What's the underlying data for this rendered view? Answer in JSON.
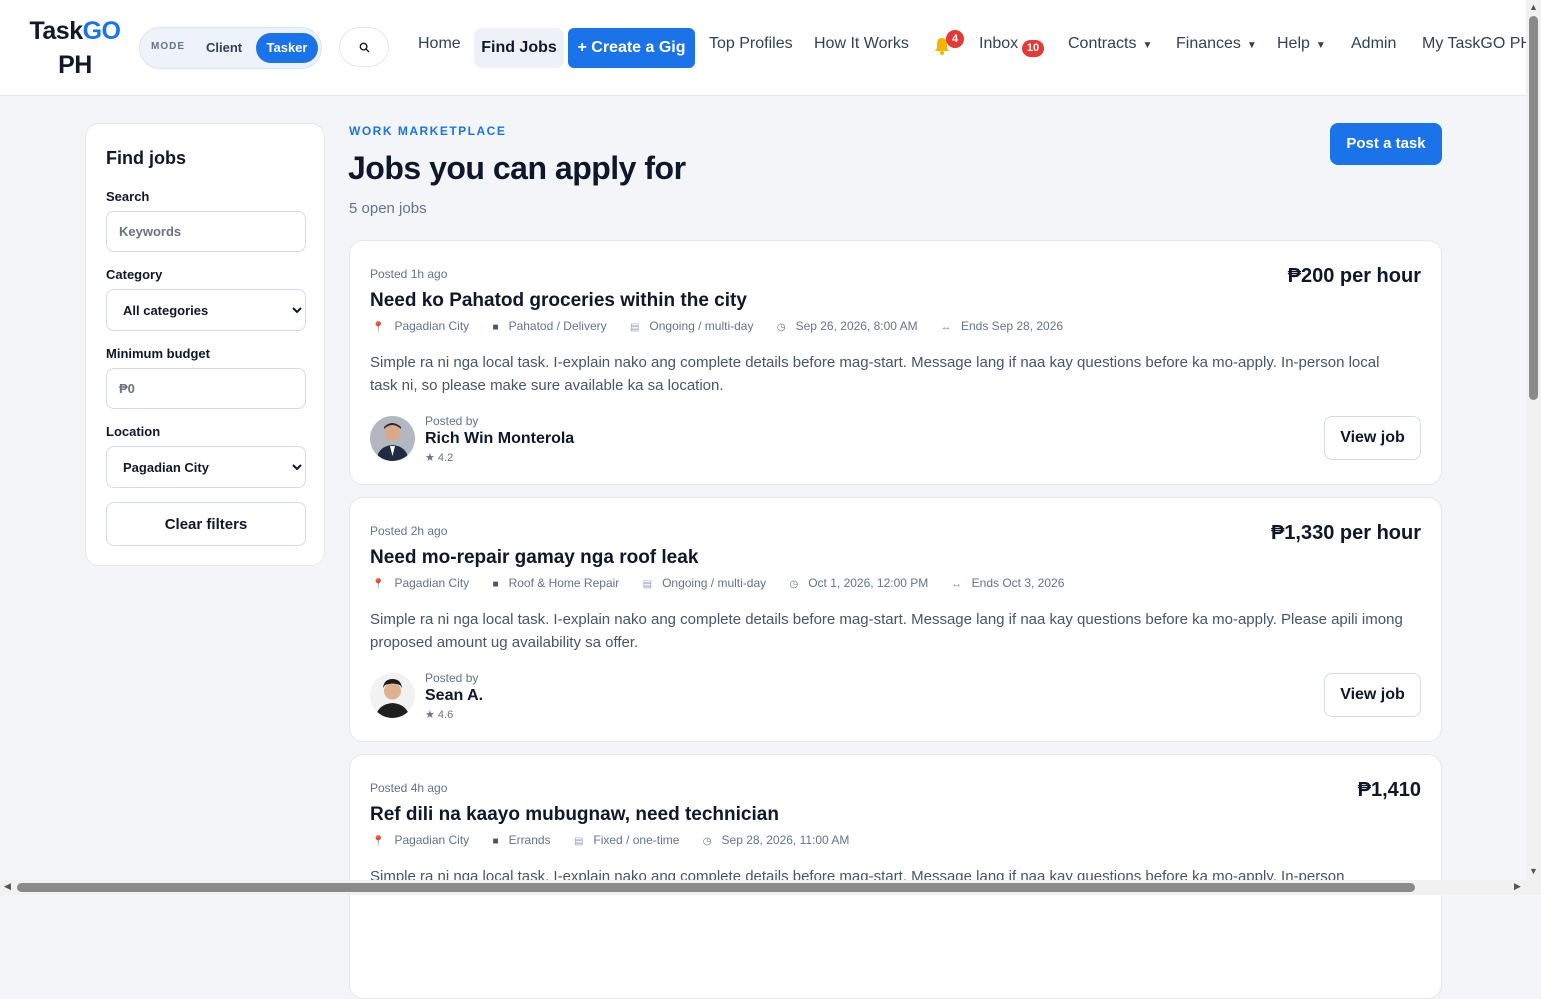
{
  "brand": {
    "part1": "Task",
    "part2": "GO",
    "part3": "PH"
  },
  "mode": {
    "label": "MODE",
    "client": "Client",
    "tasker": "Tasker"
  },
  "nav": {
    "home": "Home",
    "find_jobs": "Find Jobs",
    "create_gig": "+ Create a Gig",
    "top_profiles": "Top Profiles",
    "how_it_works": "How It Works",
    "notifications_count": "4",
    "inbox": "Inbox",
    "inbox_count": "10",
    "contracts": "Contracts",
    "finances": "Finances",
    "help": "Help",
    "admin": "Admin",
    "my_account": "My TaskGO PH",
    "caret": "▼"
  },
  "sidebar": {
    "title": "Find jobs",
    "search_label": "Search",
    "search_placeholder": "Keywords",
    "category_label": "Category",
    "category_value": "All categories",
    "budget_label": "Minimum budget",
    "budget_placeholder": "₱0",
    "location_label": "Location",
    "location_value": "Pagadian City",
    "clear_button": "Clear filters"
  },
  "main": {
    "eyebrow": "WORK MARKETPLACE",
    "title": "Jobs you can apply for",
    "count": "5 open jobs",
    "post_task": "Post a task"
  },
  "posted_by_label": "Posted by",
  "view_label": "View job",
  "jobs": [
    {
      "posted": "Posted 1h ago",
      "price": "₱200 per hour",
      "title": "Need ko Pahatod groceries within the city",
      "location": "Pagadian City",
      "category": "Pahatod / Delivery",
      "type": "Ongoing / multi-day",
      "date": "Sep 26, 2026, 8:00 AM",
      "ends": "Ends Sep 28, 2026",
      "desc": "Simple ra ni nga local task. I-explain nako ang complete details before mag-start. Message lang if naa kay questions before ka mo-apply. In-person local task ni, so please make sure available ka sa location.",
      "poster": "Rich Win Monterola",
      "rating": "★ 4.2"
    },
    {
      "posted": "Posted 2h ago",
      "price": "₱1,330 per hour",
      "title": "Need mo-repair gamay nga roof leak",
      "location": "Pagadian City",
      "category": "Roof & Home Repair",
      "type": "Ongoing / multi-day",
      "date": "Oct 1, 2026, 12:00 PM",
      "ends": "Ends Oct 3, 2026",
      "desc": "Simple ra ni nga local task. I-explain nako ang complete details before mag-start. Message lang if naa kay questions before ka mo-apply. Please apili imong proposed amount ug availability sa offer.",
      "poster": "Sean A.",
      "rating": "★ 4.6"
    },
    {
      "posted": "Posted 4h ago",
      "price": "₱1,410",
      "title": "Ref dili na kaayo mubugnaw, need technician",
      "location": "Pagadian City",
      "category": "Errands",
      "type": "Fixed / one-time",
      "date": "Sep 28, 2026, 11:00 AM",
      "desc": "Simple ra ni nga local task. I-explain nako ang complete details before mag-start. Message lang if naa kay questions before ka mo-apply. In-person"
    }
  ],
  "icons": {
    "search": "search-icon",
    "bell": "bell-icon",
    "location": "pin-icon",
    "category": "folder-icon",
    "type": "document-icon",
    "date": "clock-icon",
    "ends": "arrows-icon"
  },
  "colors": {
    "accent": "#1a73e8",
    "badge": "#e53935",
    "background": "#f3f5f9"
  }
}
